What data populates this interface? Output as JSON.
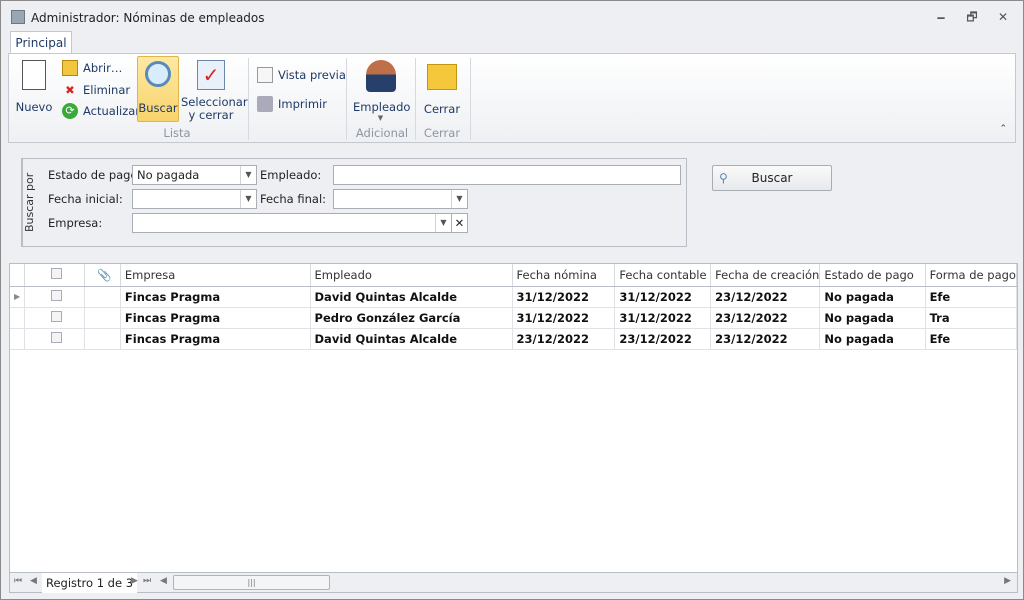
{
  "window": {
    "title": "Administrador: Nóminas de empleados",
    "minimize": "🗕",
    "restore": "🗗",
    "close": "✕"
  },
  "ribbon": {
    "tab": "Principal",
    "nuevo": "Nuevo",
    "abrir": "Abrir…",
    "eliminar": "Eliminar",
    "actualizar": "Actualizar",
    "buscar": "Buscar",
    "seleccionar": "Seleccionar",
    "seleccionar2": "y cerrar",
    "vista_previa": "Vista previa",
    "imprimir": "Imprimir",
    "empleado": "Empleado",
    "cerrar": "Cerrar",
    "groups": {
      "lista": "Lista",
      "adicional": "Adicional",
      "cerrar": "Cerrar"
    }
  },
  "filter": {
    "title": "Buscar por",
    "estado_label": "Estado de pago:",
    "estado_value": "No pagada",
    "empleado_label": "Empleado:",
    "empleado_value": "",
    "fecha_inicial_label": "Fecha inicial:",
    "fecha_final_label": "Fecha final:",
    "empresa_label": "Empresa:",
    "buscar_button": "Buscar"
  },
  "grid": {
    "columns": [
      "Empresa",
      "Empleado",
      "Fecha nómina",
      "Fecha contable",
      "Fecha de creación",
      "Estado de pago",
      "Forma de pago"
    ],
    "rows": [
      [
        "Fincas Pragma",
        "David Quintas Alcalde",
        "31/12/2022",
        "31/12/2022",
        "23/12/2022",
        "No pagada",
        "Efe"
      ],
      [
        "Fincas Pragma",
        "Pedro González García",
        "31/12/2022",
        "31/12/2022",
        "23/12/2022",
        "No pagada",
        "Tra"
      ],
      [
        "Fincas Pragma",
        "David Quintas Alcalde",
        "23/12/2022",
        "23/12/2022",
        "23/12/2022",
        "No pagada",
        "Efe"
      ]
    ]
  },
  "navigator": {
    "record": "Registro 1 de 3"
  }
}
